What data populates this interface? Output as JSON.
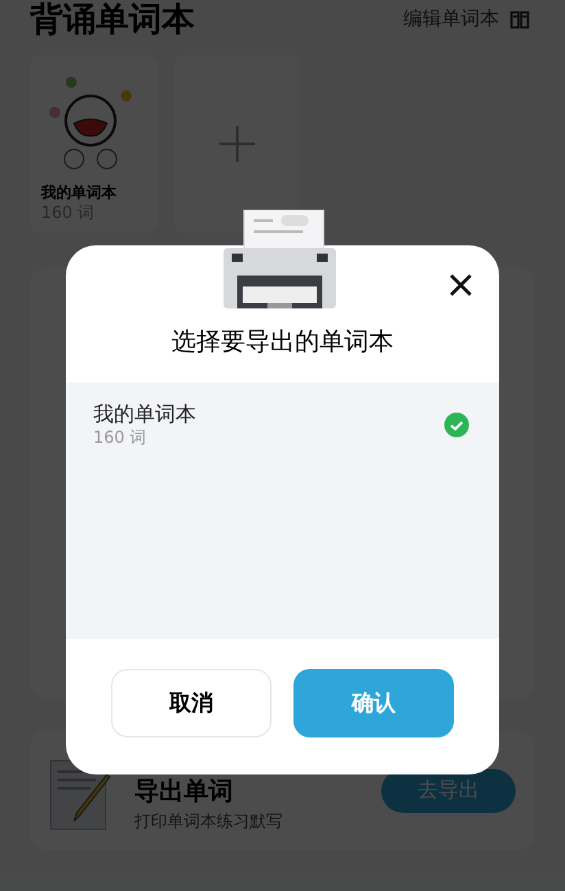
{
  "page": {
    "title": "背诵单词本",
    "edit_button": "编辑单词本",
    "wordbooks": [
      {
        "name": "我的单词本",
        "count": "160 词"
      }
    ],
    "export_card": {
      "title": "导出单词",
      "subtitle": "打印单词本练习默写",
      "button": "去导出"
    }
  },
  "dialog": {
    "title": "选择要导出的单词本",
    "books": [
      {
        "name": "我的单词本",
        "count": "160 词",
        "selected": true
      }
    ],
    "buttons": [
      {
        "label": "取消",
        "kind": "secondary"
      },
      {
        "label": "确认",
        "kind": "primary"
      }
    ]
  }
}
